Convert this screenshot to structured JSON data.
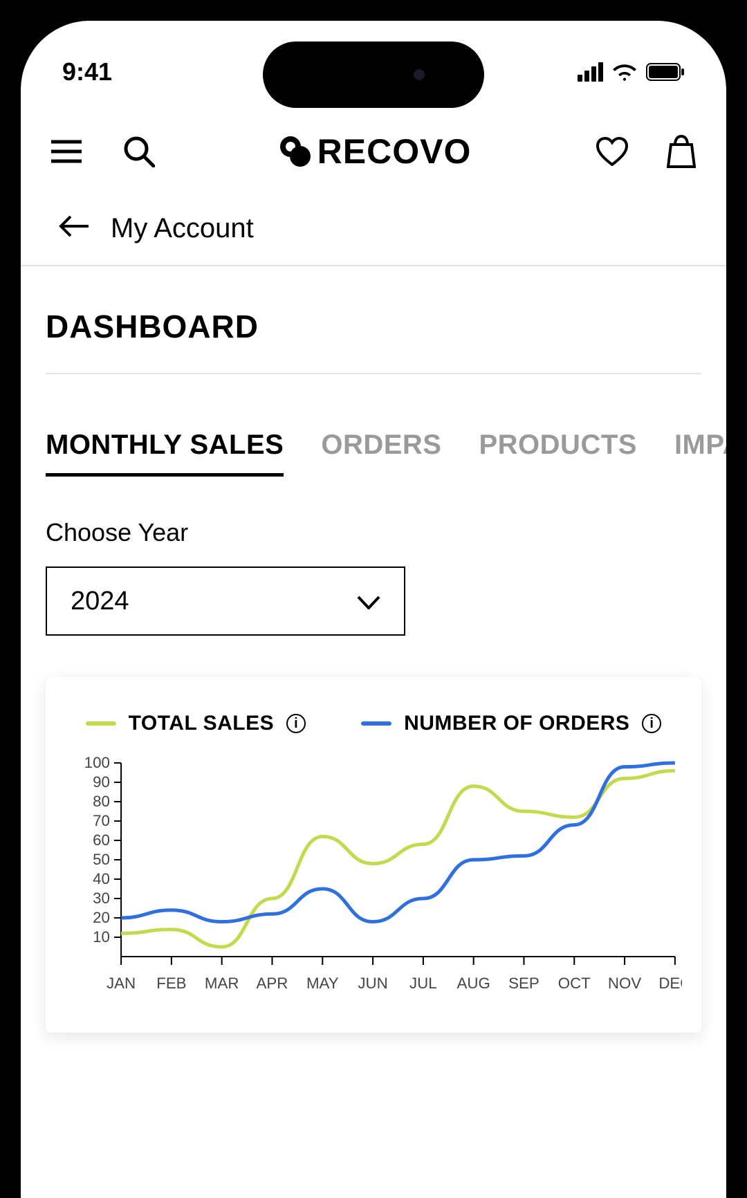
{
  "status": {
    "time": "9:41"
  },
  "brand": {
    "name": "RECOVO"
  },
  "breadcrumb": {
    "label": "My Account"
  },
  "page": {
    "title": "DASHBOARD"
  },
  "tabs": [
    {
      "label": "MONTHLY SALES",
      "active": true
    },
    {
      "label": "ORDERS",
      "active": false
    },
    {
      "label": "PRODUCTS",
      "active": false
    },
    {
      "label": "IMPA",
      "active": false
    }
  ],
  "year_select": {
    "label": "Choose Year",
    "value": "2024"
  },
  "legend": {
    "series1": "TOTAL SALES",
    "series2": "NUMBER OF ORDERS",
    "color1": "#c5d94f",
    "color2": "#2f6fe0"
  },
  "chart_data": {
    "type": "line",
    "xlabel": "",
    "ylabel": "",
    "ylim": [
      0,
      100
    ],
    "y_ticks": [
      10,
      20,
      30,
      40,
      50,
      60,
      70,
      80,
      90,
      100
    ],
    "categories": [
      "JAN",
      "FEB",
      "MAR",
      "APR",
      "MAY",
      "JUN",
      "JUL",
      "AUG",
      "SEP",
      "OCT",
      "NOV",
      "DEC"
    ],
    "series": [
      {
        "name": "TOTAL SALES",
        "color": "#c5d94f",
        "values": [
          12,
          14,
          5,
          30,
          62,
          48,
          58,
          88,
          75,
          72,
          92,
          96
        ]
      },
      {
        "name": "NUMBER OF ORDERS",
        "color": "#2f6fe0",
        "values": [
          20,
          24,
          18,
          22,
          35,
          18,
          30,
          50,
          52,
          68,
          98,
          100
        ]
      }
    ]
  }
}
